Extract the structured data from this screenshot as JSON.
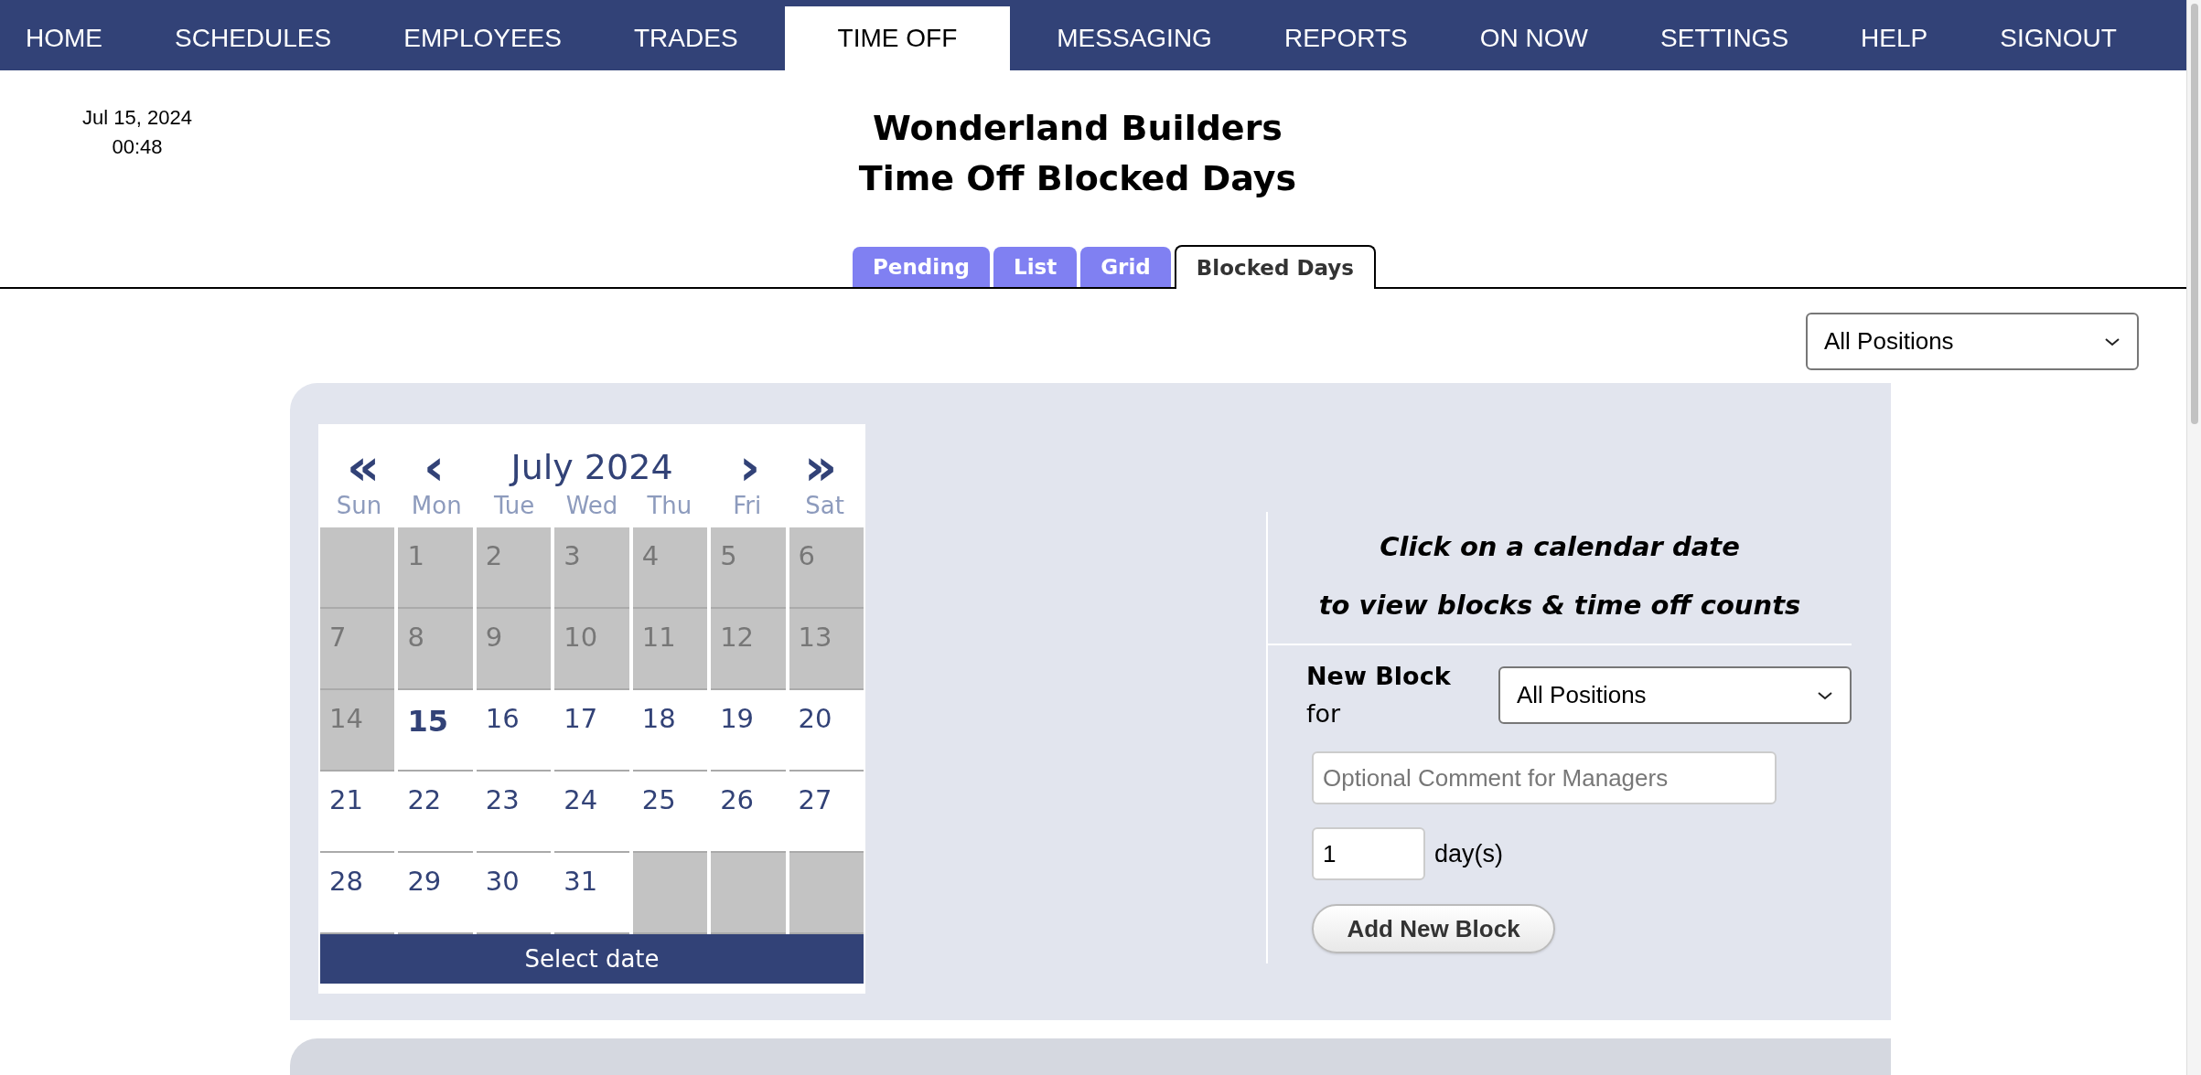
{
  "nav": [
    {
      "label": "HOME",
      "selected": false
    },
    {
      "label": "SCHEDULES",
      "selected": false
    },
    {
      "label": "EMPLOYEES",
      "selected": false
    },
    {
      "label": "TRADES",
      "selected": false
    },
    {
      "label": "TIME OFF",
      "selected": true
    },
    {
      "label": "MESSAGING",
      "selected": false
    },
    {
      "label": "REPORTS",
      "selected": false
    },
    {
      "label": "ON NOW",
      "selected": false
    },
    {
      "label": "SETTINGS",
      "selected": false
    },
    {
      "label": "HELP",
      "selected": false
    },
    {
      "label": "SIGNOUT",
      "selected": false
    }
  ],
  "clock": {
    "date": "Jul 15, 2024",
    "time": "00:48"
  },
  "title": [
    "Wonderland Builders",
    "Time Off Blocked Days"
  ],
  "tabs": [
    {
      "label": "Pending",
      "selected": false
    },
    {
      "label": "List",
      "selected": false
    },
    {
      "label": "Grid",
      "selected": false
    },
    {
      "label": "Blocked Days",
      "selected": true
    }
  ],
  "position_filter": {
    "value": "All Positions"
  },
  "calendar": {
    "prev_year": "«",
    "prev_month": "‹",
    "month": "July 2024",
    "next_month": "›",
    "next_year": "»",
    "weekdays": [
      "Sun",
      "Mon",
      "Tue",
      "Wed",
      "Thu",
      "Fri",
      "Sat"
    ],
    "days": [
      {
        "kind": "empty"
      },
      {
        "label": "1",
        "blocked": true,
        "today": false
      },
      {
        "label": "2",
        "blocked": true,
        "today": false
      },
      {
        "label": "3",
        "blocked": true,
        "today": false
      },
      {
        "label": "4",
        "blocked": true,
        "today": false
      },
      {
        "label": "5",
        "blocked": true,
        "today": false
      },
      {
        "label": "6",
        "blocked": true,
        "today": false
      },
      {
        "label": "7",
        "blocked": true,
        "today": false
      },
      {
        "label": "8",
        "blocked": true,
        "today": false
      },
      {
        "label": "9",
        "blocked": true,
        "today": false
      },
      {
        "label": "10",
        "blocked": true,
        "today": false
      },
      {
        "label": "11",
        "blocked": true,
        "today": false
      },
      {
        "label": "12",
        "blocked": true,
        "today": false
      },
      {
        "label": "13",
        "blocked": true,
        "today": false
      },
      {
        "label": "14",
        "blocked": true,
        "today": false
      },
      {
        "label": "15",
        "blocked": false,
        "today": true
      },
      {
        "label": "16",
        "blocked": false,
        "today": false
      },
      {
        "label": "17",
        "blocked": false,
        "today": false
      },
      {
        "label": "18",
        "blocked": false,
        "today": false
      },
      {
        "label": "19",
        "blocked": false,
        "today": false
      },
      {
        "label": "20",
        "blocked": false,
        "today": false
      },
      {
        "label": "21",
        "blocked": false,
        "today": false
      },
      {
        "label": "22",
        "blocked": false,
        "today": false
      },
      {
        "label": "23",
        "blocked": false,
        "today": false
      },
      {
        "label": "24",
        "blocked": false,
        "today": false
      },
      {
        "label": "25",
        "blocked": false,
        "today": false
      },
      {
        "label": "26",
        "blocked": false,
        "today": false
      },
      {
        "label": "27",
        "blocked": false,
        "today": false
      },
      {
        "label": "28",
        "blocked": false,
        "today": false
      },
      {
        "label": "29",
        "blocked": false,
        "today": false
      },
      {
        "label": "30",
        "blocked": false,
        "today": false
      },
      {
        "label": "31",
        "blocked": false,
        "today": false
      },
      {
        "kind": "empty"
      },
      {
        "kind": "empty"
      },
      {
        "kind": "empty"
      }
    ],
    "footer": "Select date"
  },
  "hint": [
    "Click on a calendar date",
    "to view blocks & time off counts"
  ],
  "new_block": {
    "label": "**New Block** for",
    "position": "All Positions",
    "comment_placeholder": "Optional Comment for Managers",
    "days_value": "1",
    "days_unit": "day(s)",
    "button": "Add New Block"
  }
}
